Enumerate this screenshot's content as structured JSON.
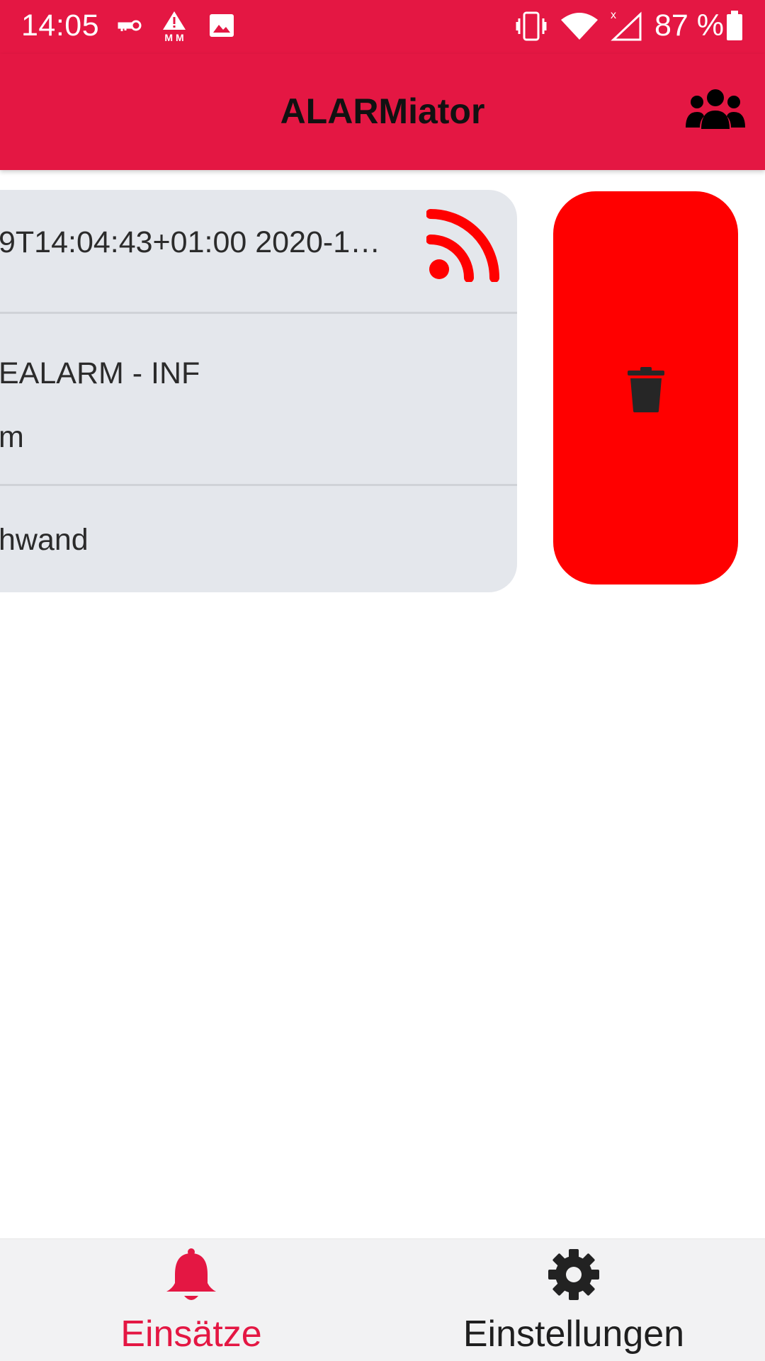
{
  "status_bar": {
    "time": "14:05",
    "battery_text": "87 %",
    "icons": [
      "key-icon",
      "warning-mm-icon",
      "image-icon",
      "vibrate-icon",
      "wifi-icon",
      "signal-icon",
      "battery-icon"
    ]
  },
  "app_bar": {
    "title": "ALARMiator",
    "action_icon": "group-icon"
  },
  "alarm_card": {
    "timestamp": "9T14:04:43+01:00 2020-12-…",
    "feed_icon": "rss-icon",
    "alarm_type": "EALARM - INF",
    "alarm_detail": "m",
    "location": "hwand"
  },
  "swipe_action": {
    "icon": "trash-icon"
  },
  "bottom_nav": {
    "items": [
      {
        "label": "Einsätze",
        "icon": "bell-icon",
        "active": true
      },
      {
        "label": "Einstellungen",
        "icon": "gear-icon",
        "active": false
      }
    ]
  },
  "colors": {
    "primary": "#e41743",
    "delete": "#ff0000",
    "card": "#e4e7ec",
    "nav_background": "#f2f2f3"
  }
}
